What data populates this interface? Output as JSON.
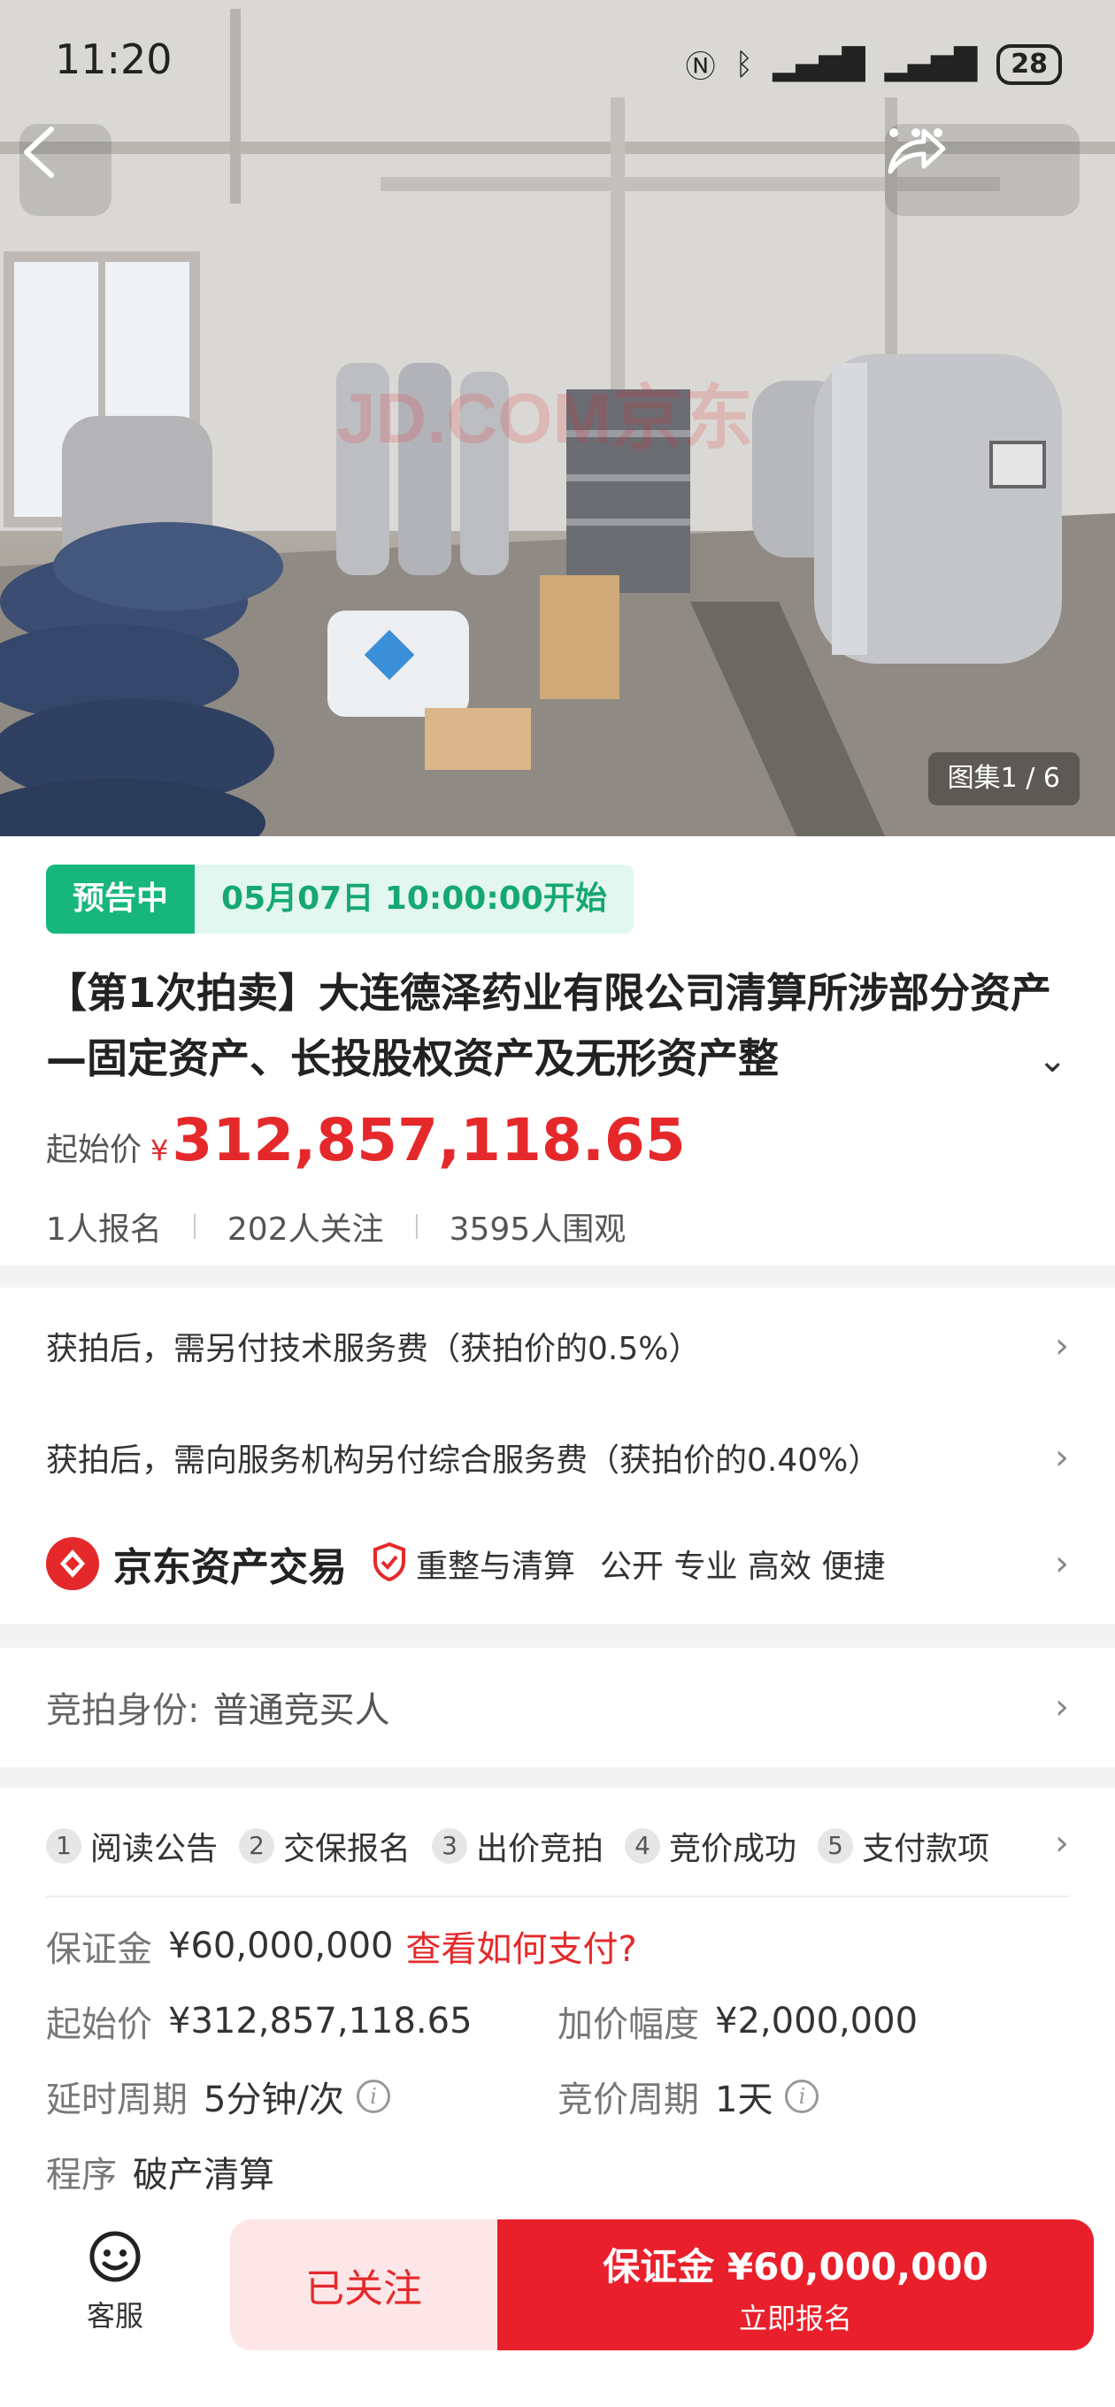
{
  "status_bar": {
    "time": "11:20",
    "battery": "28"
  },
  "gallery": {
    "label": "图集",
    "current": "1",
    "total": "6",
    "watermark": "JD.COM京东"
  },
  "auction": {
    "status_tag": "预告中",
    "start_time": "05月07日 10:00:00开始",
    "title": "【第1次拍卖】大连德泽药业有限公司清算所涉部分资产—固定资产、长投股权资产及无形资产整",
    "start_price_label": "起始价",
    "currency": "¥",
    "start_price": "312,857,118.65",
    "stats": [
      "1人报名",
      "202人关注",
      "3595人围观"
    ]
  },
  "fees": {
    "tech_fee": "获拍后，需另付技术服务费（获拍价的0.5%）",
    "service_fee": "获拍后，需向服务机构另付综合服务费（获拍价的0.40%）"
  },
  "platform": {
    "name": "京东资产交易",
    "badge": "重整与清算",
    "tagline": "公开 专业 高效 便捷"
  },
  "identity": {
    "label": "竞拍身份:",
    "value": "普通竞买人"
  },
  "steps": [
    {
      "num": "1",
      "label": "阅读公告"
    },
    {
      "num": "2",
      "label": "交保报名"
    },
    {
      "num": "3",
      "label": "出价竞拍"
    },
    {
      "num": "4",
      "label": "竞价成功"
    },
    {
      "num": "5",
      "label": "支付款项"
    }
  ],
  "details": {
    "deposit_label": "保证金",
    "deposit_value": "¥60,000,000",
    "deposit_link": "查看如何支付?",
    "start_price_label": "起始价",
    "start_price_value": "¥312,857,118.65",
    "increment_label": "加价幅度",
    "increment_value": "¥2,000,000",
    "delay_label": "延时周期",
    "delay_value": "5分钟/次",
    "cycle_label": "竞价周期",
    "cycle_value": "1天",
    "procedure_label": "程序",
    "procedure_value": "破产清算"
  },
  "bottom_bar": {
    "customer_service": "客服",
    "follow_label": "已关注",
    "signup_deposit": "保证金 ¥60,000,000",
    "signup_label": "立即报名"
  },
  "colors": {
    "accent_red": "#e9202b",
    "preview_green": "#16b67c"
  }
}
